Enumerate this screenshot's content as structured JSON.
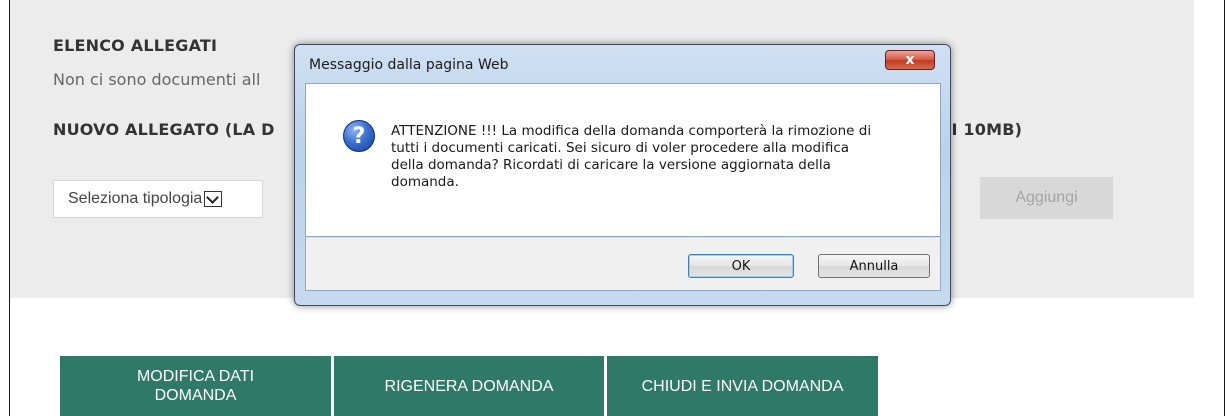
{
  "page": {
    "elenco_title": "ELENCO ALLEGATI",
    "elenco_text": "Non ci sono documenti all",
    "nuovo_title_left": "NUOVO ALLEGATO (LA D",
    "nuovo_title_right": "DI 10MB)",
    "select_value": "Seleziona tipologia",
    "add_button": "Aggiungi",
    "actions": [
      {
        "label": "MODIFICA DATI DOMANDA"
      },
      {
        "label": "RIGENERA DOMANDA"
      },
      {
        "label": "CHIUDI E INVIA DOMANDA"
      }
    ],
    "colors": {
      "panel": "#ececec",
      "action_button": "#2e7a66",
      "add_button": "#d8d8d8"
    }
  },
  "dialog": {
    "title": "Messaggio dalla pagina Web",
    "close_label": "x",
    "icon": "question-icon",
    "message_lines": [
      "ATTENZIONE !!! La modifica della domanda comporterà la rimozione di",
      "tutti i documenti caricati. Sei sicuro di voler procedere alla modifica",
      "della domanda? Ricordati di caricare la versione aggiornata della",
      "domanda."
    ],
    "ok_label": "OK",
    "cancel_label": "Annulla"
  }
}
